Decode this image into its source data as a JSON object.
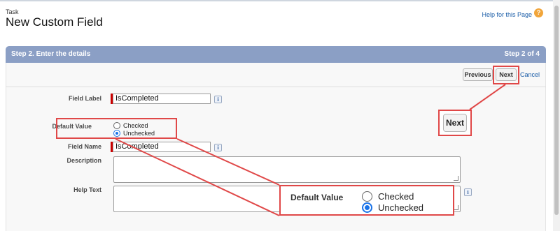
{
  "header": {
    "object_name": "Task",
    "title": "New Custom Field",
    "help_link": "Help for this Page",
    "help_icon": "question-circle-icon"
  },
  "step": {
    "title": "Step 2. Enter the details",
    "count": "Step 2 of 4"
  },
  "buttons": {
    "previous": "Previous",
    "next": "Next",
    "cancel": "Cancel"
  },
  "form": {
    "field_label": {
      "label": "Field Label",
      "value": "IsCompleted"
    },
    "default_value": {
      "label": "Default Value",
      "options": [
        "Checked",
        "Unchecked"
      ],
      "selected": "Unchecked"
    },
    "field_name": {
      "label": "Field Name",
      "value": "IsCompleted"
    },
    "description": {
      "label": "Description",
      "value": ""
    },
    "help_text": {
      "label": "Help Text",
      "value": ""
    },
    "info_icon": "i"
  },
  "callouts": {
    "next_zoom": "Next",
    "default_zoom": {
      "label": "Default Value",
      "options": [
        "Checked",
        "Unchecked"
      ],
      "selected": "Unchecked"
    }
  },
  "colors": {
    "step_header": "#8b9fc5",
    "callout": "#e04848",
    "required": "#cc0000",
    "link": "#1c5ea8"
  }
}
